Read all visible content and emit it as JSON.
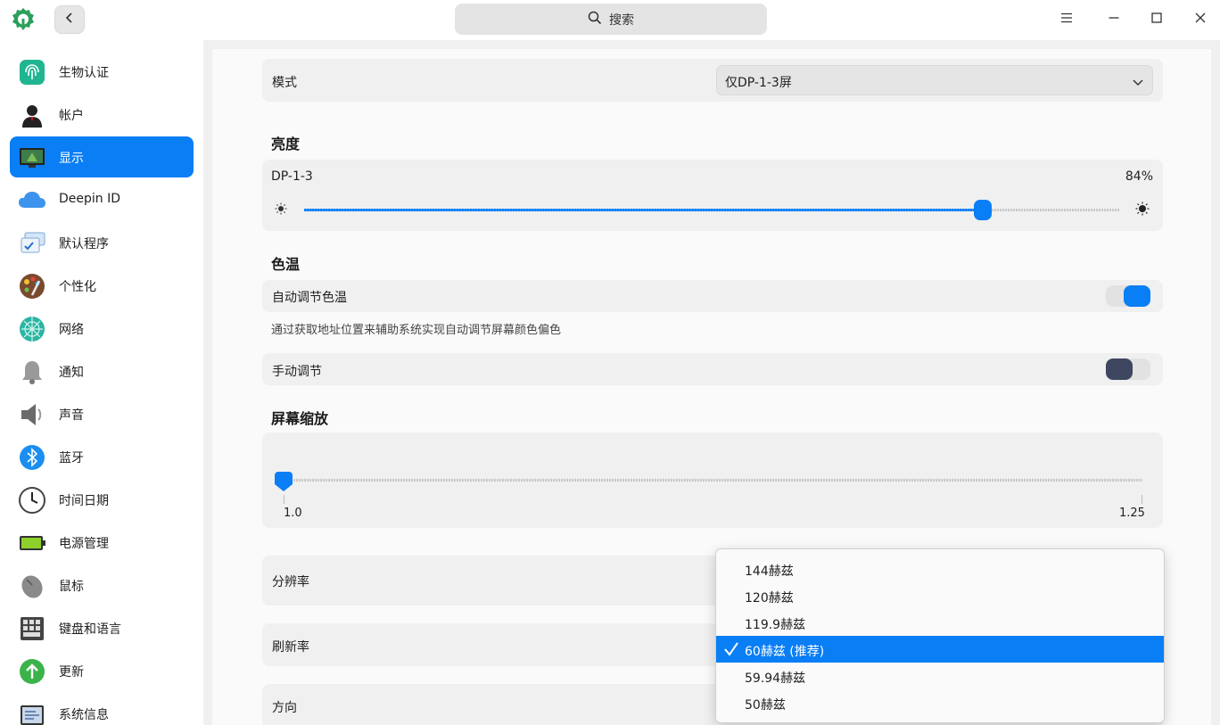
{
  "titlebar": {
    "search_placeholder": "搜索"
  },
  "sidebar": {
    "items": [
      {
        "label": "生物认证",
        "icon": "fingerprint-icon"
      },
      {
        "label": "帐户",
        "icon": "account-icon"
      },
      {
        "label": "显示",
        "icon": "display-icon",
        "active": true
      },
      {
        "label": "Deepin ID",
        "icon": "cloud-icon"
      },
      {
        "label": "默认程序",
        "icon": "default-apps-icon"
      },
      {
        "label": "个性化",
        "icon": "palette-icon"
      },
      {
        "label": "网络",
        "icon": "network-icon"
      },
      {
        "label": "通知",
        "icon": "bell-icon"
      },
      {
        "label": "声音",
        "icon": "speaker-icon"
      },
      {
        "label": "蓝牙",
        "icon": "bluetooth-icon"
      },
      {
        "label": "时间日期",
        "icon": "clock-icon"
      },
      {
        "label": "电源管理",
        "icon": "battery-icon"
      },
      {
        "label": "鼠标",
        "icon": "mouse-icon"
      },
      {
        "label": "键盘和语言",
        "icon": "keyboard-icon"
      },
      {
        "label": "更新",
        "icon": "update-icon"
      },
      {
        "label": "系统信息",
        "icon": "system-info-icon"
      }
    ]
  },
  "display": {
    "mode_label": "模式",
    "mode_value": "仅DP-1-3屏",
    "brightness_title": "亮度",
    "brightness_monitor": "DP-1-3",
    "brightness_value": "84%",
    "brightness_level": 0.84,
    "color_temp_title": "色温",
    "auto_color_temp_label": "自动调节色温",
    "auto_color_temp_on": true,
    "auto_color_temp_note": "通过获取地址位置来辅助系统实现自动调节屏幕颜色偏色",
    "manual_label": "手动调节",
    "manual_on": false,
    "scaling_title": "屏幕缩放",
    "scaling_min": "1.0",
    "scaling_max": "1.25",
    "scaling_level": 0.0,
    "resolution_label": "分辨率",
    "refresh_label": "刷新率",
    "orientation_label": "方向"
  },
  "refresh_dropdown": {
    "options": [
      "144赫兹",
      "120赫兹",
      "119.9赫兹",
      "60赫兹 (推荐)",
      "59.94赫兹",
      "50赫兹"
    ],
    "selected_index": 3
  },
  "colors": {
    "accent": "#0a7ef5",
    "toggle_off_knob": "#3f4760"
  }
}
